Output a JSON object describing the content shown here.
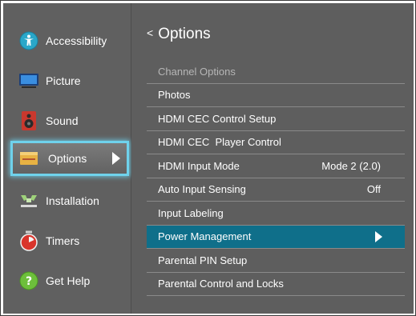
{
  "sidebar": {
    "items": [
      {
        "label": "Accessibility",
        "icon": "accessibility-icon"
      },
      {
        "label": "Picture",
        "icon": "picture-icon"
      },
      {
        "label": "Sound",
        "icon": "speaker-icon"
      },
      {
        "label": "Options",
        "icon": "options-icon",
        "selected": true
      },
      {
        "label": "Installation",
        "icon": "installation-icon"
      },
      {
        "label": "Timers",
        "icon": "timer-icon"
      },
      {
        "label": "Get Help",
        "icon": "help-icon"
      }
    ]
  },
  "main": {
    "back_glyph": "<",
    "title": "Options",
    "items": [
      {
        "label": "Channel Options",
        "value": ""
      },
      {
        "label": "Photos",
        "value": ""
      },
      {
        "label": "HDMI CEC Control Setup",
        "value": ""
      },
      {
        "label": "HDMI CEC  Player Control",
        "value": ""
      },
      {
        "label": "HDMI Input Mode",
        "value": "Mode 2 (2.0)"
      },
      {
        "label": "Auto Input Sensing",
        "value": "Off"
      },
      {
        "label": "Input Labeling",
        "value": ""
      },
      {
        "label": "Power Management",
        "value": "",
        "selected": true
      },
      {
        "label": "Parental PIN Setup",
        "value": ""
      },
      {
        "label": "Parental Control and Locks",
        "value": ""
      }
    ]
  },
  "colors": {
    "panel_bg": "#5e5e5e",
    "sidebar_bg": "#606060",
    "selected_row": "#0f6f8a",
    "selected_glow": "#6fd2ec"
  }
}
